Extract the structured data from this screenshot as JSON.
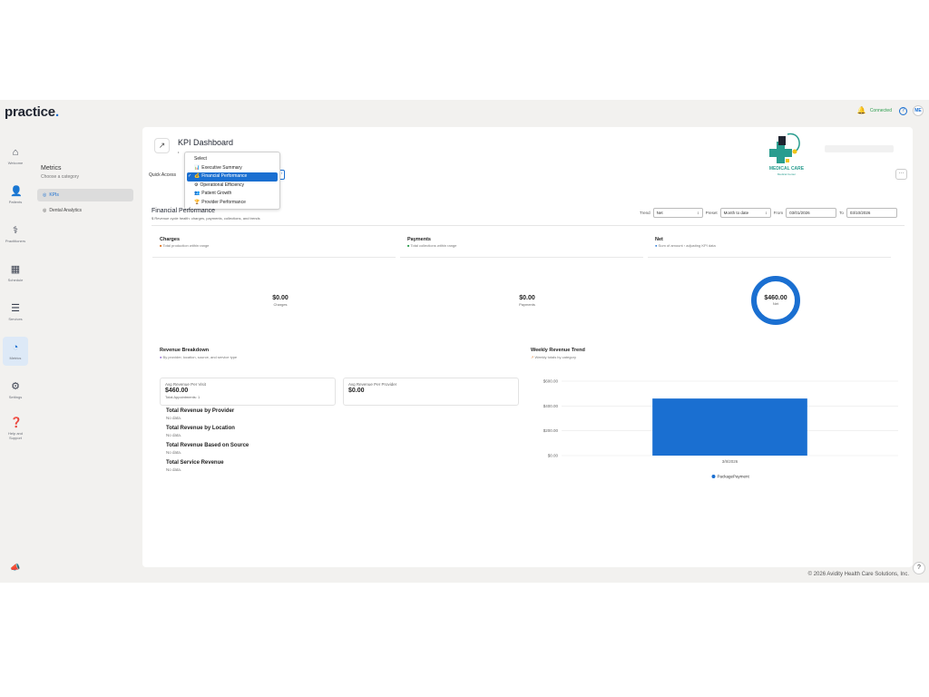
{
  "app": {
    "logo": "practice",
    "status": "Connected",
    "help": "?",
    "avatar_initials": "ME",
    "footer": "© 2026 Avidity Health Care Solutions, Inc.",
    "help_fab": "?"
  },
  "nav": [
    {
      "label": "Welcome",
      "icon": "home-icon"
    },
    {
      "label": "Patients",
      "icon": "patients-icon"
    },
    {
      "label": "Practitioners",
      "icon": "practitioners-icon"
    },
    {
      "label": "Schedule",
      "icon": "calendar-icon"
    },
    {
      "label": "Services",
      "icon": "layers-icon"
    },
    {
      "label": "Metrics",
      "icon": "metrics-icon",
      "active": true
    },
    {
      "label": "Settings",
      "icon": "gear-icon"
    },
    {
      "label": "Help and Support",
      "icon": "help-icon"
    }
  ],
  "submenu": {
    "title": "Metrics",
    "description": "Choose a category",
    "items": [
      {
        "label": "KPIs",
        "active": true
      },
      {
        "label": "Dental Analytics"
      }
    ]
  },
  "header": {
    "title": "KPI Dashboard",
    "quick_access_label": "Quick Access",
    "brand_name": "MEDICAL CARE",
    "brand_tagline": "Medical Center",
    "more": "···"
  },
  "dropdown": {
    "header": "Select",
    "options": [
      {
        "label": "Executive Summary",
        "icon": "📊"
      },
      {
        "label": "Financial Performance",
        "icon": "💰",
        "selected": true
      },
      {
        "label": "Operational Efficiency",
        "icon": "⚙"
      },
      {
        "label": "Patient Growth",
        "icon": "👥"
      },
      {
        "label": "Provider Performance",
        "icon": "🏆"
      }
    ]
  },
  "financial": {
    "title": "Financial Performance",
    "subtitle": "Revenue cycle health: charges, payments, collections, and trends",
    "filters": {
      "trend_label": "Trend",
      "trend_value": "Net",
      "preset_label": "Preset",
      "preset_value": "Month to date",
      "from_label": "From",
      "from_value": "03/01/2026",
      "to_label": "To",
      "to_value": "03/10/2026"
    },
    "metrics": [
      {
        "title": "Charges",
        "desc": "Total production within range",
        "value": "$0.00",
        "label": "Charges",
        "color": "#e07b2d"
      },
      {
        "title": "Payments",
        "desc": "Total collections within range",
        "value": "$0.00",
        "label": "Payments",
        "color": "#2e9e4f"
      },
      {
        "title": "Net",
        "desc": "Sum of amount › adjusting KPI data",
        "value": "$460.00",
        "label": "Net",
        "color": "#1a6fd1"
      }
    ]
  },
  "revenue_breakdown": {
    "title": "Revenue Breakdown",
    "subtitle": "By provider, location, source, and service type",
    "kpis": [
      {
        "label": "Avg Revenue Per Visit",
        "value": "$460.00",
        "sub": "Total Appointments: 1"
      },
      {
        "label": "Avg Revenue Per Provider",
        "value": "$0.00",
        "sub": ""
      }
    ],
    "lists": [
      {
        "title": "Total Revenue by Provider",
        "note": "No data."
      },
      {
        "title": "Total Revenue by Location",
        "note": "No data."
      },
      {
        "title": "Total Revenue Based on Source",
        "note": "No data."
      },
      {
        "title": "Total Service Revenue",
        "note": "No data."
      }
    ]
  },
  "weekly_trend": {
    "title": "Weekly Revenue Trend",
    "subtitle": "Weekly totals by category"
  },
  "chart_data": {
    "type": "bar",
    "categories": [
      "3/8/2026"
    ],
    "series": [
      {
        "name": "PackagePayment",
        "values": [
          460
        ],
        "color": "#1a6fd1"
      }
    ],
    "yticks": [
      "$0.00",
      "$200.00",
      "$400.00",
      "$600.00"
    ],
    "ylim": [
      0,
      600
    ],
    "grid": true,
    "legend": "bottom"
  }
}
